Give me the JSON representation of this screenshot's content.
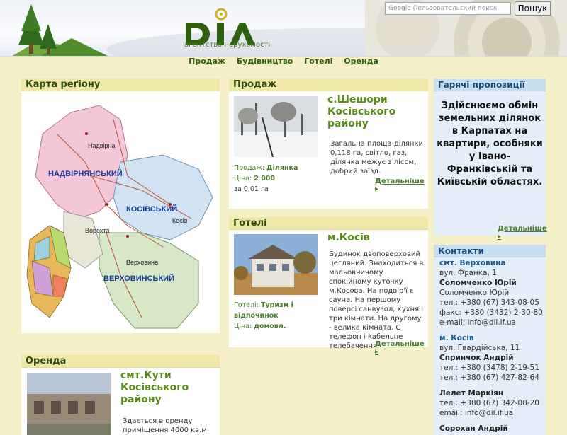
{
  "brand": {
    "logo_text": "DIЛ",
    "tagline": "агентство нерухомості"
  },
  "search": {
    "placeholder": "Пользовательский поиск",
    "google_label": "Google",
    "button_label": "Пошук"
  },
  "nav": {
    "items": [
      "Продаж",
      "Будівництво",
      "Готелі",
      "Оренда"
    ]
  },
  "map_panel": {
    "header": "Карта реґіону",
    "regions": [
      "НАДВІРНЯНСЬКИЙ",
      "КОСІВСЬКИЙ",
      "ВЕРХОВИНСЬКИЙ"
    ],
    "towns": [
      "Надвірна",
      "Ворохта",
      "Косів",
      "Верховина"
    ]
  },
  "sale": {
    "header": "Продаж",
    "title": "с.Шешори Косівського району",
    "description": "Загальна площа ділянки 0,118 га, світло, газ, ділянка межує з лісом, добрий заїзд.",
    "type_label": "Продаж:",
    "type_value": "Ділянка",
    "price_label": "Ціна:",
    "price_value": "2 000",
    "price_unit": "за 0,01 га",
    "more": "Детальніше"
  },
  "hotels": {
    "header": "Готелі",
    "title": "м.Косів",
    "description": "Будинок двоповерховий цегляний. Знаходиться в мальовничому спокійному куточку м.Косова. На подвір'ї є сауна. На першому поверсі санвузол, кухня і три кімнати. На другому - велика кімната. Є телефон і кабельне телебачення.",
    "type_label": "Готелі:",
    "type_value": "Туризм і відпочинок",
    "price_label": "Ціна:",
    "price_value": "домовл.",
    "more": "Детальніше"
  },
  "rent": {
    "header": "Оренда",
    "title": "смт.Кути Косівського району",
    "description": "Здається в оренду приміщення 4000 кв.м."
  },
  "hot_offers": {
    "header": "Гарячі пропозиції",
    "text": "Здійснюємо обмін земельних ділянок в Карпатах на квартири, особняки у Івано-Франківській та Київській областях.",
    "more": "Детальніше"
  },
  "contacts": {
    "header": "Контакти",
    "lines": [
      {
        "text": "смт. Верховина",
        "style": "c"
      },
      {
        "text": "вул. Франка, 1",
        "style": ""
      },
      {
        "text": "Соломченко Юрій",
        "style": "p"
      },
      {
        "text": "Соломченко Юрій",
        "style": ""
      },
      {
        "text": "тел.: +380 (67) 343-08-05",
        "style": ""
      },
      {
        "text": "факс: +380 (3432) 2-30-80",
        "style": ""
      },
      {
        "text": "e-mail: info@dil.if.ua",
        "style": ""
      },
      {
        "text": "",
        "style": ""
      },
      {
        "text": "м. Косів",
        "style": "c"
      },
      {
        "text": "вул. Гвардійська, 11",
        "style": ""
      },
      {
        "text": "Спринчок Андрій",
        "style": "p"
      },
      {
        "text": "тел.: +380 (3478) 2-19-51",
        "style": ""
      },
      {
        "text": "тел.: +380 (67) 427-82-64",
        "style": ""
      },
      {
        "text": "",
        "style": ""
      },
      {
        "text": "Лелет Маркіян",
        "style": "p"
      },
      {
        "text": "тел.: +380 (67) 342-08-20",
        "style": ""
      },
      {
        "text": "email: info@dil.if.ua",
        "style": ""
      },
      {
        "text": "",
        "style": ""
      },
      {
        "text": "Сорохан Андрій",
        "style": "p"
      }
    ]
  },
  "colors": {
    "accent_green": "#5a8a1a",
    "header_yellow": "#efe8a8",
    "header_blue": "#c8dff0",
    "page_bg": "#f5f0c8"
  }
}
